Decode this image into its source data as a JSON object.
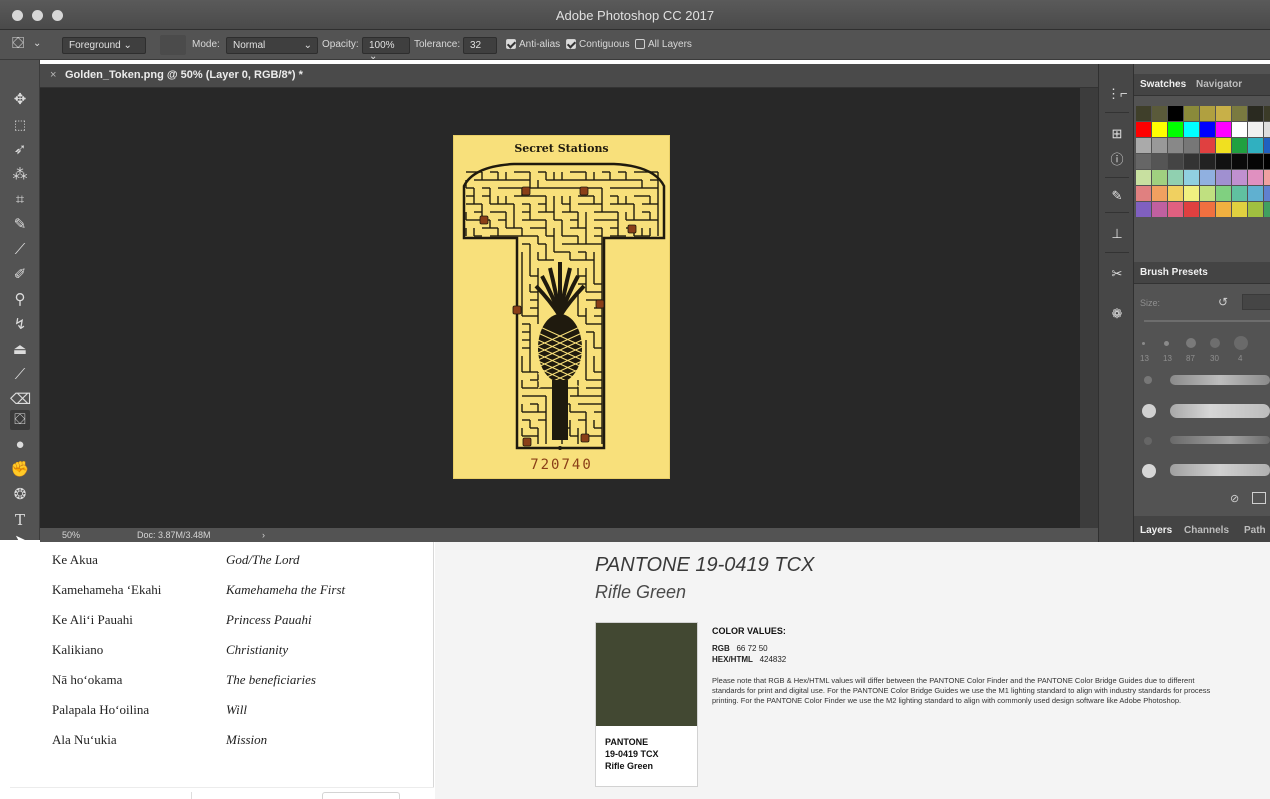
{
  "window": {
    "title": "Adobe Photoshop CC 2017"
  },
  "options_bar": {
    "fill_source": "Foreground",
    "mode_label": "Mode:",
    "mode_value": "Normal",
    "opacity_label": "Opacity:",
    "opacity_value": "100%",
    "tolerance_label": "Tolerance:",
    "tolerance_value": "32",
    "anti_alias_label": "Anti-alias",
    "anti_alias_checked": true,
    "contiguous_label": "Contiguous",
    "contiguous_checked": true,
    "all_layers_label": "All Layers",
    "all_layers_checked": false
  },
  "document": {
    "tab_close": "×",
    "tab_title": "Golden_Token.png @ 50% (Layer 0, RGB/8*) *",
    "zoom": "50%",
    "doc_size": "Doc: 3.87M/3.48M",
    "status_arrow": "›"
  },
  "artwork": {
    "title": "Secret Stations",
    "number": "720740",
    "background_color": "#f8e07b",
    "ink_color": "#1f1a0e",
    "station_color": "#8a3f18"
  },
  "panels": {
    "top_tabs": [
      "Swatches",
      "Navigator"
    ],
    "brush_tab": "Brush Presets",
    "brush_size_label": "Size:",
    "brush_sizes": [
      "13",
      "13",
      "87",
      "30",
      "4"
    ],
    "bottom_tabs": [
      "Layers",
      "Channels",
      "Path"
    ]
  },
  "swatches": {
    "rows": [
      [
        "#3f3f2a",
        "#5a5a3a",
        "#000000",
        "#8a8a3a",
        "#b0a040",
        "#c8b048",
        "#7a7a40",
        "#2a2a20",
        "#3b3b28"
      ],
      [
        "#ff0000",
        "#ffff00",
        "#00ff00",
        "#00ffff",
        "#0000ff",
        "#ff00ff",
        "#ffffff",
        "#f0f0f0",
        "#dddddd"
      ],
      [
        "#aaaaaa",
        "#999999",
        "#888888",
        "#777777",
        "#e04040",
        "#f0e020",
        "#20a040",
        "#30b0c0",
        "#2060c0"
      ],
      [
        "#666666",
        "#555555",
        "#444444",
        "#333333",
        "#222222",
        "#111111",
        "#0a0a0a",
        "#050505",
        "#000000"
      ],
      [
        "#c8e0a0",
        "#a0d080",
        "#90d0b0",
        "#90d0e0",
        "#90b0e0",
        "#a090d0",
        "#c090d0",
        "#e090c0",
        "#f0a0a0"
      ],
      [
        "#e08080",
        "#f0a060",
        "#f0d060",
        "#f0f080",
        "#c0e080",
        "#80d080",
        "#60c0a0",
        "#60b0d0",
        "#6080d0"
      ],
      [
        "#8060c0",
        "#c060a0",
        "#e06080",
        "#e04040",
        "#f07040",
        "#f0b040",
        "#e0d040",
        "#a0c040",
        "#40a060"
      ]
    ]
  },
  "vocab": [
    {
      "haw": "Ke Akua",
      "eng": "God/The Lord"
    },
    {
      "haw": "Kamehameha ʻEkahi",
      "eng": "Kamehameha the First"
    },
    {
      "haw": "Ke Aliʻi Pauahi",
      "eng": "Princess Pauahi"
    },
    {
      "haw": "Kalikiano",
      "eng": "Christianity"
    },
    {
      "haw": "Nā hoʻokama",
      "eng": "The beneficiaries"
    },
    {
      "haw": "Palapala Hoʻoilina",
      "eng": "Will"
    },
    {
      "haw": "Ala Nuʻukia",
      "eng": "Mission"
    }
  ],
  "pantone": {
    "code": "PANTONE  19-0419 TCX",
    "name": "Rifle Green",
    "chip_color": "#424832",
    "chip_label_1": "PANTONE",
    "chip_label_2": "19-0419 TCX",
    "chip_label_3": "Rifle Green",
    "values_title": "COLOR VALUES:",
    "rgb_label": "RGB",
    "rgb_value": "66  72  50",
    "hex_label": "HEX/HTML",
    "hex_value": "424832",
    "note": "Please note that RGB & Hex/HTML values will differ between the PANTONE Color Finder and the PANTONE Color Bridge Guides due to different standards for print and digital use. For the PANTONE Color Bridge Guides we use the M1 lighting standard to align with industry standards for process printing. For the PANTONE Color Finder we use the M2 lighting standard to align with commonly used design software like Adobe Photoshop."
  }
}
